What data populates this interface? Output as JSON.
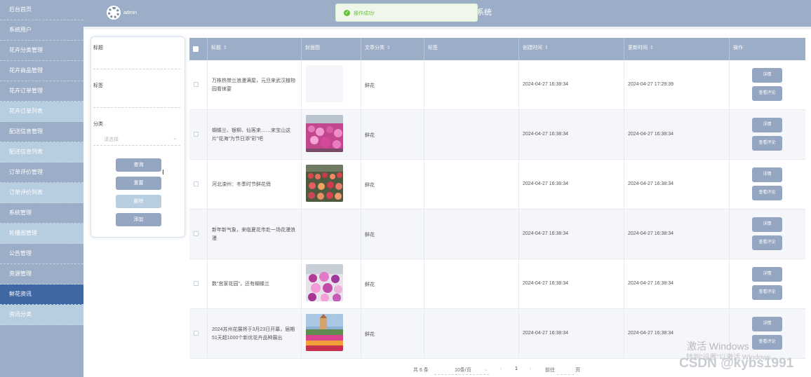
{
  "sidebar": {
    "items": [
      {
        "label": "后台首页"
      },
      {
        "label": "系统用户"
      },
      {
        "label": "花卉分类管理"
      },
      {
        "label": "花卉商品管理"
      },
      {
        "label": "花卉订单管理"
      },
      {
        "label": "花卉订单列表"
      },
      {
        "label": "配送信息管理"
      },
      {
        "label": "配送信息列表"
      },
      {
        "label": "订单评价管理"
      },
      {
        "label": "订单评价列表"
      },
      {
        "label": "系统管理"
      },
      {
        "label": "轮播图管理"
      },
      {
        "label": "公告管理"
      },
      {
        "label": "资源管理"
      },
      {
        "label": "鲜花资讯"
      },
      {
        "label": "资讯分类"
      }
    ],
    "active_index": 14
  },
  "header": {
    "user": "admin",
    "title_fragment": "系统"
  },
  "toast": {
    "message": "操作成功!"
  },
  "search": {
    "title_label": "标题",
    "tag_label": "标签",
    "category_label": "分类",
    "category_placeholder": "请选择",
    "buttons": {
      "query": "查询",
      "reset": "重置",
      "delete": "删除",
      "add": "添加"
    }
  },
  "table": {
    "headers": {
      "title": "标题",
      "cover": "封面图",
      "category": "文章分类",
      "tags": "标签",
      "created": "创建时间",
      "updated": "更新时间",
      "actions": "操作"
    },
    "rows": [
      {
        "title": "万株热带兰浪漫满屋，元旦来武汉植物园看徕宴",
        "category": "鲜花",
        "tags": "",
        "created": "2024-04-27 16:38:34",
        "updated": "2024-04-27 17:29:39",
        "cover": "none",
        "detail": "详情",
        "comment": "查看评论"
      },
      {
        "title": "蝴蝶兰、银柳、仙客来……来宝山这片\"花海\"为节日添\"彩\"吧",
        "category": "鲜花",
        "tags": "",
        "created": "2024-04-27 16:38:34",
        "updated": "2024-04-27 16:38:34",
        "cover": "orchid-greenhouse",
        "detail": "详情",
        "comment": "查看评论"
      },
      {
        "title": "河北滦州：冬季时节鲜花俏",
        "category": "鲜花",
        "tags": "",
        "created": "2024-04-27 16:38:34",
        "updated": "2024-04-27 16:38:34",
        "cover": "potted-flowers",
        "detail": "详情",
        "comment": "查看评论"
      },
      {
        "title": "新年新气象，来临夏花市赴一场花漫浪漫",
        "category": "鲜花",
        "tags": "",
        "created": "2024-04-27 16:38:34",
        "updated": "2024-04-27 16:38:34",
        "cover": "none",
        "detail": "详情",
        "comment": "查看评论"
      },
      {
        "title": "数\"宫家花园\"，还有蝴蝶兰",
        "category": "鲜花",
        "tags": "",
        "created": "2024-04-27 16:38:34",
        "updated": "2024-04-27 16:38:34",
        "cover": "purple-orchids",
        "detail": "详情",
        "comment": "查看评论"
      },
      {
        "title": "2024苏州花展将于3月23日开幕，届期51天超1000个新优花卉品种展出",
        "category": "鲜花",
        "tags": "",
        "created": "2024-04-27 16:38:34",
        "updated": "2024-04-27 16:38:34",
        "cover": "tulip-field",
        "detail": "详情",
        "comment": "查看评论"
      }
    ]
  },
  "pagination": {
    "total": "共 6 条",
    "page_size": "10条/页",
    "prev": "‹",
    "current_page": "1",
    "next": "›",
    "goto_label": "前往",
    "page_unit": "页"
  },
  "watermarks": {
    "windows_line1": "激活 Windows",
    "windows_line2": "转到\"设置\"以激活 Windows。",
    "csdn": "CSDN @kybs1991"
  },
  "colors": {
    "sidebar": "#9badc7",
    "sidebar_active": "#3f67a3",
    "sidebar_sub": "#b7cde0",
    "button": "#94a6c2",
    "toast_green": "#67c23a"
  }
}
